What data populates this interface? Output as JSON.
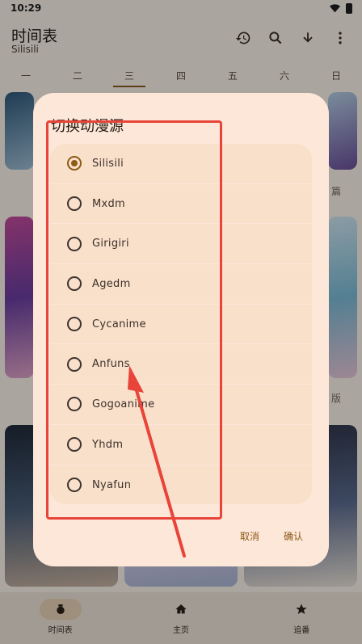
{
  "status_bar": {
    "time": "10:29"
  },
  "header": {
    "title": "时间表",
    "subtitle": "Silisili"
  },
  "toolbar_icons": [
    "history-icon",
    "search-icon",
    "download-icon",
    "more-vert-icon"
  ],
  "week_tabs": [
    {
      "label": "一",
      "active": false
    },
    {
      "label": "二",
      "active": false
    },
    {
      "label": "三",
      "active": true
    },
    {
      "label": "四",
      "active": false
    },
    {
      "label": "五",
      "active": false
    },
    {
      "label": "六",
      "active": false
    },
    {
      "label": "日",
      "active": false
    }
  ],
  "background_captions": [
    "篇",
    "版"
  ],
  "dialog": {
    "title": "切换动漫源",
    "options": [
      {
        "label": "Silisili",
        "selected": true
      },
      {
        "label": "Mxdm",
        "selected": false
      },
      {
        "label": "Girigiri",
        "selected": false
      },
      {
        "label": "Agedm",
        "selected": false
      },
      {
        "label": "Cycanime",
        "selected": false
      },
      {
        "label": "Anfuns",
        "selected": false
      },
      {
        "label": "Gogoanime",
        "selected": false
      },
      {
        "label": "Yhdm",
        "selected": false
      },
      {
        "label": "Nyafun",
        "selected": false
      }
    ],
    "cancel_label": "取消",
    "confirm_label": "确认"
  },
  "bottom_nav": [
    {
      "label": "时间表",
      "icon": "timetable-icon",
      "active": true
    },
    {
      "label": "主页",
      "icon": "home-icon",
      "active": false
    },
    {
      "label": "追番",
      "icon": "star-icon",
      "active": false
    }
  ],
  "colors": {
    "accent": "#8d5b18",
    "dialog_bg": "#fde7d9",
    "annotation_red": "#e8443a",
    "nav_active": "#e7d3b6"
  }
}
